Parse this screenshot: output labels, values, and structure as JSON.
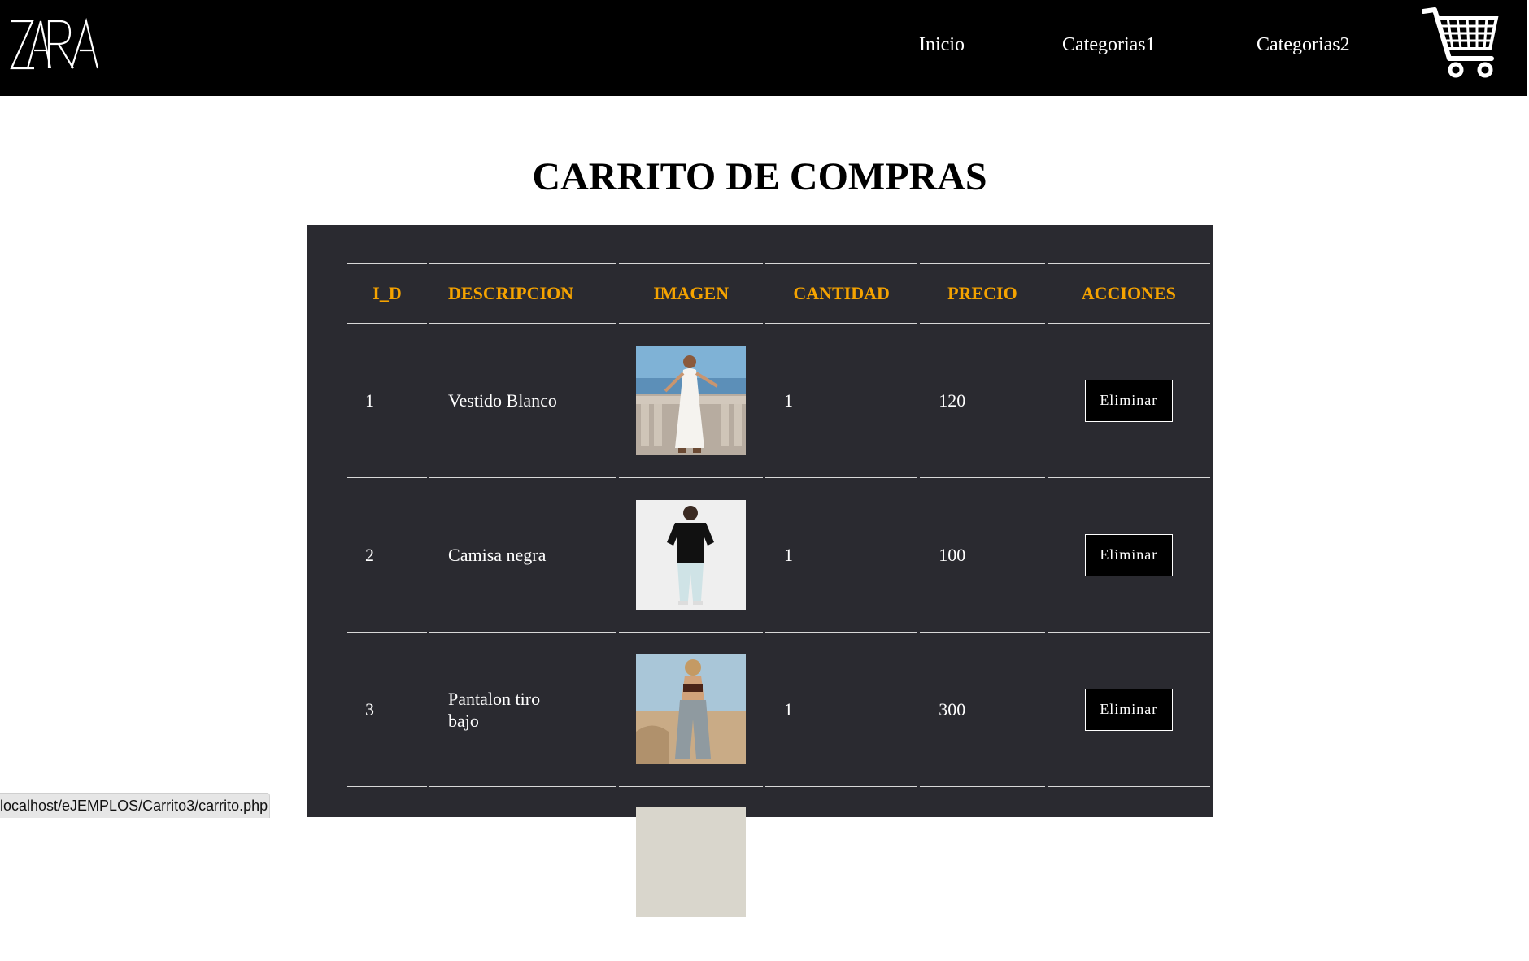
{
  "header": {
    "logo_text": "ZARA",
    "nav": [
      {
        "label": "Inicio"
      },
      {
        "label": "Categorias1"
      },
      {
        "label": "Categorias2"
      }
    ],
    "cart_icon": "shopping-cart-icon"
  },
  "page_title": "CARRITO DE COMPRAS",
  "table": {
    "columns": [
      "I_D",
      "DESCRIPCION",
      "IMAGEN",
      "CANTIDAD",
      "PRECIO",
      "ACCIONES"
    ],
    "rows": [
      {
        "id": "1",
        "description": "Vestido Blanco",
        "image": "woman-white-dress-photo",
        "quantity": "1",
        "price": "120",
        "action": "Eliminar"
      },
      {
        "id": "2",
        "description": "Camisa negra",
        "image": "man-black-shirt-photo",
        "quantity": "1",
        "price": "100",
        "action": "Eliminar"
      },
      {
        "id": "3",
        "description": "Pantalon tiro bajo",
        "image": "woman-low-rise-jeans-photo",
        "quantity": "1",
        "price": "300",
        "action": "Eliminar"
      }
    ]
  },
  "status_bar": {
    "url": "localhost/eJEMPLOS/Carrito3/carrito.php"
  },
  "colors": {
    "header_bg": "#000000",
    "panel_bg": "#2a2a30",
    "column_header": "#f5a300"
  }
}
